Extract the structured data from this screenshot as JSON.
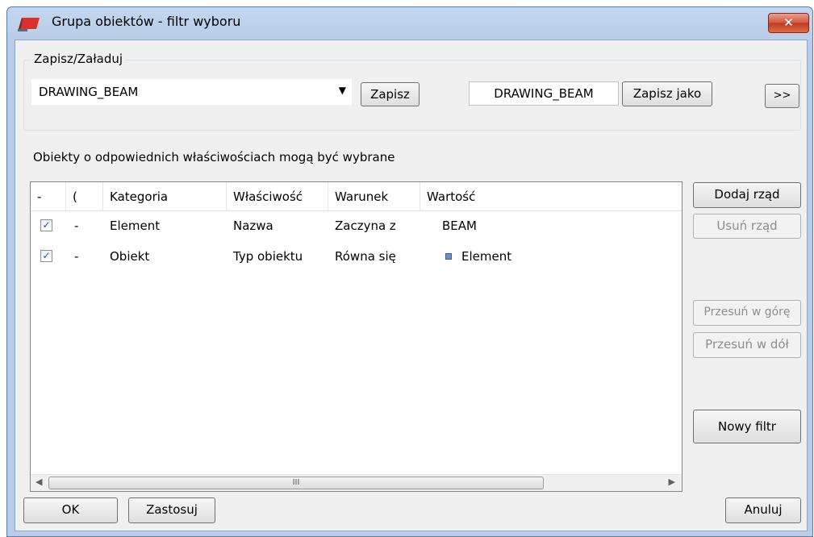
{
  "window": {
    "title": "Grupa obiektów - filtr wyboru",
    "close_label": "✕"
  },
  "save_load": {
    "group_label": "Zapisz/Załaduj",
    "selected_filter": "DRAWING_BEAM",
    "save_label": "Zapisz",
    "save_as_name": "DRAWING_BEAM",
    "save_as_label": "Zapisz jako",
    "expand_label": ">>"
  },
  "info_text": "Obiekty o odpowiednich właściwościach mogą być wybrane",
  "table": {
    "headers": [
      "-",
      "(",
      "Kategoria",
      "Właściwość",
      "Warunek",
      "Wartość"
    ],
    "rows": [
      {
        "checked": true,
        "dash": "-",
        "category": "Element",
        "property": "Nazwa",
        "condition": "Zaczyna z",
        "value": "BEAM",
        "value_icon": false
      },
      {
        "checked": true,
        "dash": "-",
        "category": "Obiekt",
        "property": "Typ obiektu",
        "condition": "Równa się",
        "value": "Element",
        "value_icon": true
      }
    ],
    "scroll_thumb_label": "III"
  },
  "side_buttons": {
    "add_row": "Dodaj rząd",
    "remove_row": "Usuń rząd",
    "move_up": "Przesuń w górę",
    "move_down": "Przesuń w dół",
    "new_filter": "Nowy filtr"
  },
  "footer": {
    "ok": "OK",
    "apply": "Zastosuj",
    "cancel": "Anuluj"
  }
}
